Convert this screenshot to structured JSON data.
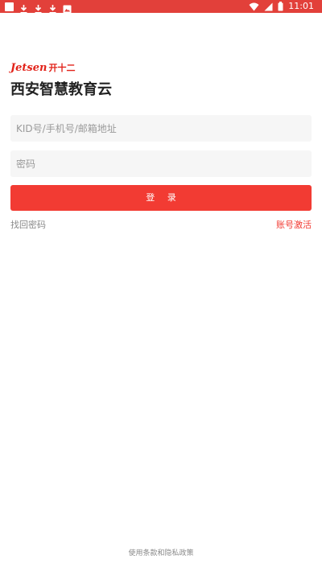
{
  "status_bar": {
    "time": "11:01",
    "left_icons": [
      "notification-square-icon",
      "download-icon",
      "download-icon",
      "download-icon",
      "image-notification-icon"
    ],
    "right_icons": [
      "wifi-icon",
      "signal-icon",
      "battery-icon"
    ],
    "background": "#e2403a"
  },
  "logo": {
    "latin": "Jetsen",
    "chinese": "开十二",
    "color": "#e2231a"
  },
  "title": "西安智慧教育云",
  "form": {
    "account_placeholder": "KID号/手机号/邮箱地址",
    "password_placeholder": "密码",
    "login_label": "登 录"
  },
  "links": {
    "recover_password": "找回密码",
    "activate_account": "账号激活"
  },
  "footer": {
    "terms": "使用条款和隐私政策"
  },
  "colors": {
    "accent": "#f23b33",
    "field_bg": "#f6f6f6",
    "text_muted": "#8a8a8a"
  }
}
